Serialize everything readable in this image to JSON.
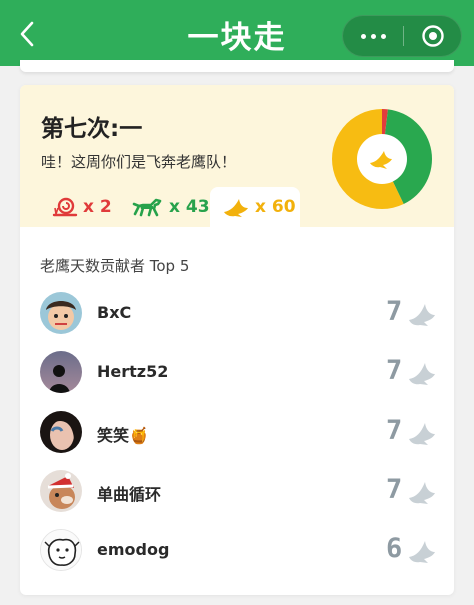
{
  "nav": {
    "title": "一块走",
    "back_icon": "back-chevron-icon",
    "more_icon": "more-dots-icon",
    "close_icon": "target-close-icon"
  },
  "round": {
    "title": "第七次:一",
    "subtitle": "哇！这周你们是飞奔老鹰队！",
    "chart_icon": "eagle-icon",
    "pie": [
      {
        "name": "snail",
        "value": 2,
        "color": "#e23d3d"
      },
      {
        "name": "horse",
        "value": 43,
        "color": "#29a84f"
      },
      {
        "name": "eagle",
        "value": 60,
        "color": "#f7bc12"
      }
    ]
  },
  "counts": [
    {
      "icon": "snail-icon",
      "label": "x 2",
      "color": "#e03a3a",
      "active": false
    },
    {
      "icon": "horse-icon",
      "label": "x 43",
      "color": "#27a24b",
      "active": false
    },
    {
      "icon": "eagle-icon",
      "label": "x 60",
      "color": "#f2b10c",
      "active": true
    }
  ],
  "section": {
    "title": "老鹰天数贡献者 Top 5"
  },
  "contributors": [
    {
      "name": "BxC",
      "score": "7",
      "avatar": "avatar-bxc"
    },
    {
      "name": "Hertz52",
      "score": "7",
      "avatar": "avatar-hertz52"
    },
    {
      "name": "笑笑🍯",
      "score": "7",
      "avatar": "avatar-xiaoxiao"
    },
    {
      "name": "单曲循环",
      "score": "7",
      "avatar": "avatar-danqu"
    },
    {
      "name": "emodog",
      "score": "6",
      "avatar": "avatar-emodog"
    }
  ],
  "colors": {
    "brand_green": "#2fae5a",
    "score_gray": "#8e9aa2",
    "eagle_yellow": "#f7bc12"
  }
}
